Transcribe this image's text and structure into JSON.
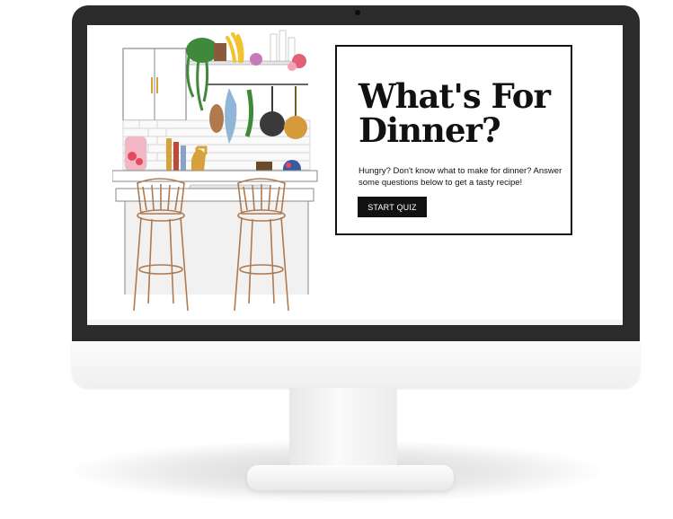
{
  "hero": {
    "title": "What's For Dinner?",
    "subtitle": "Hungry? Don't know what to make for dinner? Answer some questions below to get a tasty recipe!",
    "cta_label": "START QUIZ"
  },
  "illustration": {
    "subject": "kitchen-with-bar-stools-icon",
    "stools": 2
  },
  "colors": {
    "bezel": "#2b2b2b",
    "button_bg": "#111111",
    "button_text": "#ffffff",
    "copper": "#b07a4f",
    "brass": "#d8a23a"
  }
}
